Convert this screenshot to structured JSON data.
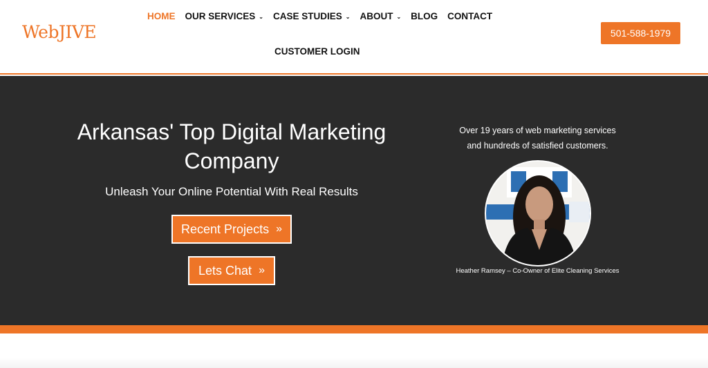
{
  "header": {
    "logo": "WebJIVE",
    "nav": [
      {
        "label": "HOME",
        "active": true,
        "dropdown": false
      },
      {
        "label": "OUR SERVICES",
        "active": false,
        "dropdown": true
      },
      {
        "label": "CASE STUDIES",
        "active": false,
        "dropdown": true
      },
      {
        "label": "ABOUT",
        "active": false,
        "dropdown": true
      },
      {
        "label": "BLOG",
        "active": false,
        "dropdown": false
      },
      {
        "label": "CONTACT",
        "active": false,
        "dropdown": false
      }
    ],
    "login": "CUSTOMER LOGIN",
    "phone": "501-588-1979"
  },
  "hero": {
    "title": "Arkansas' Top Digital Marketing Company",
    "subtitle": "Unleash Your Online Potential With Real Results",
    "buttons": {
      "recent_projects": "Recent Projects",
      "lets_chat": "Lets Chat"
    },
    "tagline_line1": "Over 19 years of web  marketing services",
    "tagline_line2": "and hundreds of satisfied customers.",
    "caption": "Heather Ramsey – Co-Owner of Elite Cleaning Services"
  },
  "colors": {
    "accent": "#ee7527",
    "hero_bg": "#2b2b2b",
    "text_dark": "#111111"
  },
  "icons": {
    "chevron": "chevron-down-icon",
    "double_arrow": "double-chevron-right-icon"
  }
}
